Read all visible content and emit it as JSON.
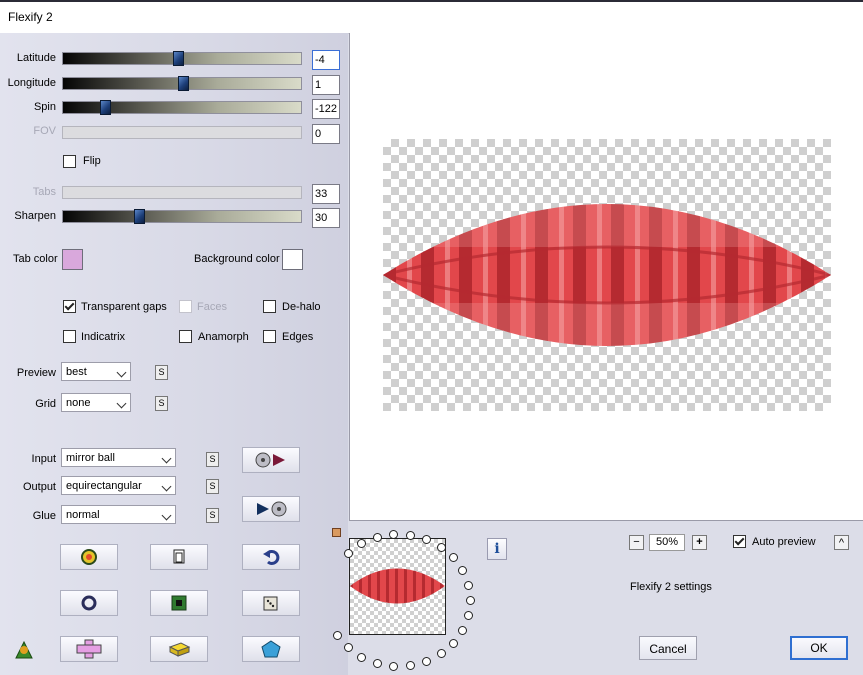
{
  "window": {
    "title": "Flexify 2"
  },
  "sliders": [
    {
      "key": "latitude",
      "label": "Latitude",
      "value": "-4",
      "position": 0.48,
      "disabled": false
    },
    {
      "key": "longitude",
      "label": "Longitude",
      "value": "1",
      "position": 0.5,
      "disabled": false
    },
    {
      "key": "spin",
      "label": "Spin",
      "value": "-122",
      "position": 0.16,
      "disabled": false
    },
    {
      "key": "fov",
      "label": "FOV",
      "value": "0",
      "position": null,
      "disabled": true
    },
    {
      "key": "tabs",
      "label": "Tabs",
      "value": "33",
      "position": null,
      "disabled": true
    },
    {
      "key": "sharpen",
      "label": "Sharpen",
      "value": "30",
      "position": 0.31,
      "disabled": false
    }
  ],
  "flip": {
    "label": "Flip",
    "checked": false
  },
  "tab_color": {
    "label": "Tab color",
    "color": "#d9a8dc"
  },
  "background_color": {
    "label": "Background color",
    "color": "#ffffff"
  },
  "options": {
    "transparent_gaps": {
      "label": "Transparent gaps",
      "checked": true
    },
    "faces": {
      "label": "Faces",
      "checked": false,
      "disabled": true
    },
    "de_halo": {
      "label": "De-halo",
      "checked": false
    },
    "indicatrix": {
      "label": "Indicatrix",
      "checked": false
    },
    "anamorph": {
      "label": "Anamorph",
      "checked": false
    },
    "edges": {
      "label": "Edges",
      "checked": false
    }
  },
  "preview_select": {
    "label": "Preview",
    "value": "best"
  },
  "grid_select": {
    "label": "Grid",
    "value": "none"
  },
  "input_select": {
    "label": "Input",
    "value": "mirror ball"
  },
  "output_select": {
    "label": "Output",
    "value": "equirectangular"
  },
  "glue_select": {
    "label": "Glue",
    "value": "normal"
  },
  "s_button_label": "S",
  "zoom": {
    "value": "50%",
    "minus": "−",
    "plus": "+"
  },
  "auto_preview": {
    "label": "Auto preview",
    "checked": true
  },
  "settings_name": "Flexify 2 settings",
  "buttons": {
    "cancel": "Cancel",
    "ok": "OK",
    "info": "i",
    "collapse": "^"
  },
  "colors": {
    "lens_main": "#e2474b",
    "lens_dark": "#b52a30",
    "lens_light": "#f5a0a0"
  }
}
